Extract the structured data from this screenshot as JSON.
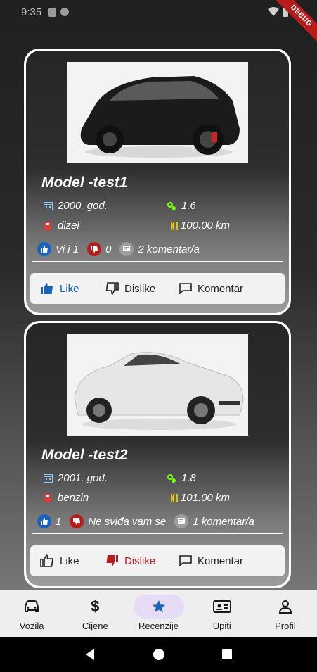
{
  "status": {
    "time": "9:35",
    "debug": "DEBUG"
  },
  "cards": [
    {
      "model": "Model -test1",
      "year": "2000. god.",
      "engine": "1.6",
      "fuel": "dizel",
      "mileage": "100.00 km",
      "likes_text": "Vi i 1",
      "dislikes_text": "0",
      "comments_text": "2 komentar/a",
      "like_label": "Like",
      "dislike_label": "Dislike",
      "comment_label": "Komentar",
      "state": "liked",
      "car_color": "#1b1b1b"
    },
    {
      "model": "Model -test2",
      "year": "2001. god.",
      "engine": "1.8",
      "fuel": "benzin",
      "mileage": "101.00 km",
      "likes_text": "1",
      "dislikes_text": "Ne sviđa vam se",
      "comments_text": "1 komentar/a",
      "like_label": "Like",
      "dislike_label": "Dislike",
      "comment_label": "Komentar",
      "state": "disliked",
      "car_color": "#e6e6e6"
    }
  ],
  "nav": {
    "items": [
      {
        "label": "Vozila",
        "icon": "car-icon"
      },
      {
        "label": "Cijene",
        "icon": "dollar-icon"
      },
      {
        "label": "Recenzije",
        "icon": "star-icon",
        "active": true
      },
      {
        "label": "Upiti",
        "icon": "contact-card-icon"
      },
      {
        "label": "Profil",
        "icon": "person-icon"
      }
    ]
  },
  "colors": {
    "blue": "#1565c0",
    "red": "#b71c1c",
    "active_nav": "#e6dcf6"
  }
}
